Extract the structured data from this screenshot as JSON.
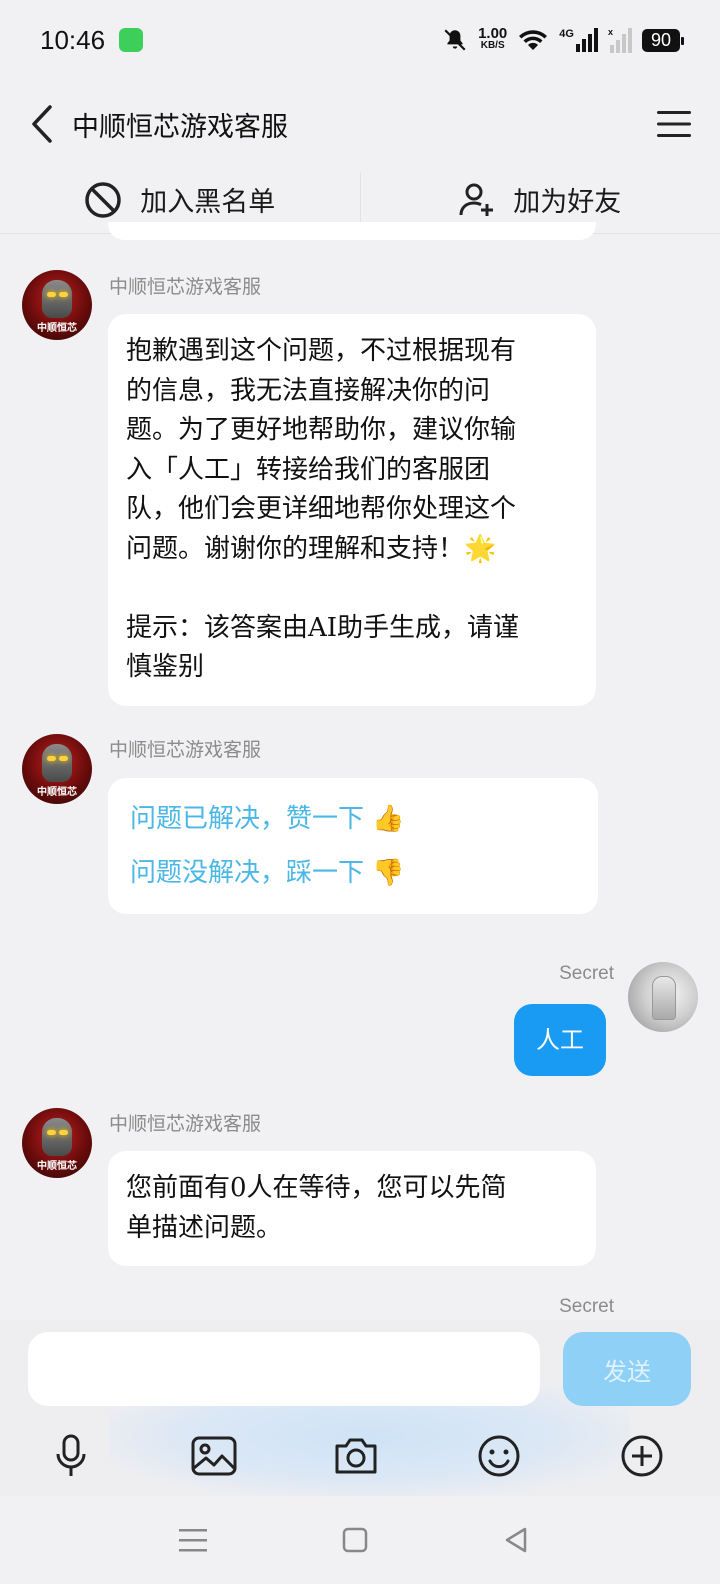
{
  "status_bar": {
    "time": "10:46",
    "net_speed_value": "1.00",
    "net_speed_unit": "KB/S",
    "network_type": "4G",
    "battery": "90"
  },
  "header": {
    "title": "中顺恒芯游戏客服"
  },
  "actions": {
    "block_label": "加入黑名单",
    "add_friend_label": "加为好友"
  },
  "messages": {
    "bot_name": "中顺恒芯游戏客服",
    "bot_avatar_text": "中顺恒芯",
    "user_name": "Secret",
    "m1_line1": "抱歉遇到这个问题，不过根据现有",
    "m1_line2": "的信息，我无法直接解决你的问",
    "m1_line3": "题。为了更好地帮助你，建议你输",
    "m1_line4": "入「人工」转接给我们的客服团",
    "m1_line5": "队，他们会更详细地帮你处理这个",
    "m1_line6": "问题。谢谢你的理解和支持！🌟",
    "m1_line7": "提示：该答案由AI助手生成，请谨",
    "m1_line8": "慎鉴别",
    "feedback_solved": "问题已解决，赞一下 👍",
    "feedback_unsolved": "问题没解决，踩一下 👎",
    "user_msg": "人工",
    "m3_line1": "您前面有0人在等待，您可以先简",
    "m3_line2": "单描述问题。"
  },
  "composer": {
    "input_value": "",
    "send_label": "发送"
  },
  "colors": {
    "accent": "#1a9bf3",
    "link": "#4bb7e6",
    "send_disabled": "#8fd0f6"
  },
  "icons": [
    "back-icon",
    "menu-icon",
    "block-icon",
    "add-user-icon",
    "mic-icon",
    "image-icon",
    "camera-icon",
    "emoji-icon",
    "plus-icon",
    "nav-menu-icon",
    "nav-home-icon",
    "nav-back-icon"
  ]
}
